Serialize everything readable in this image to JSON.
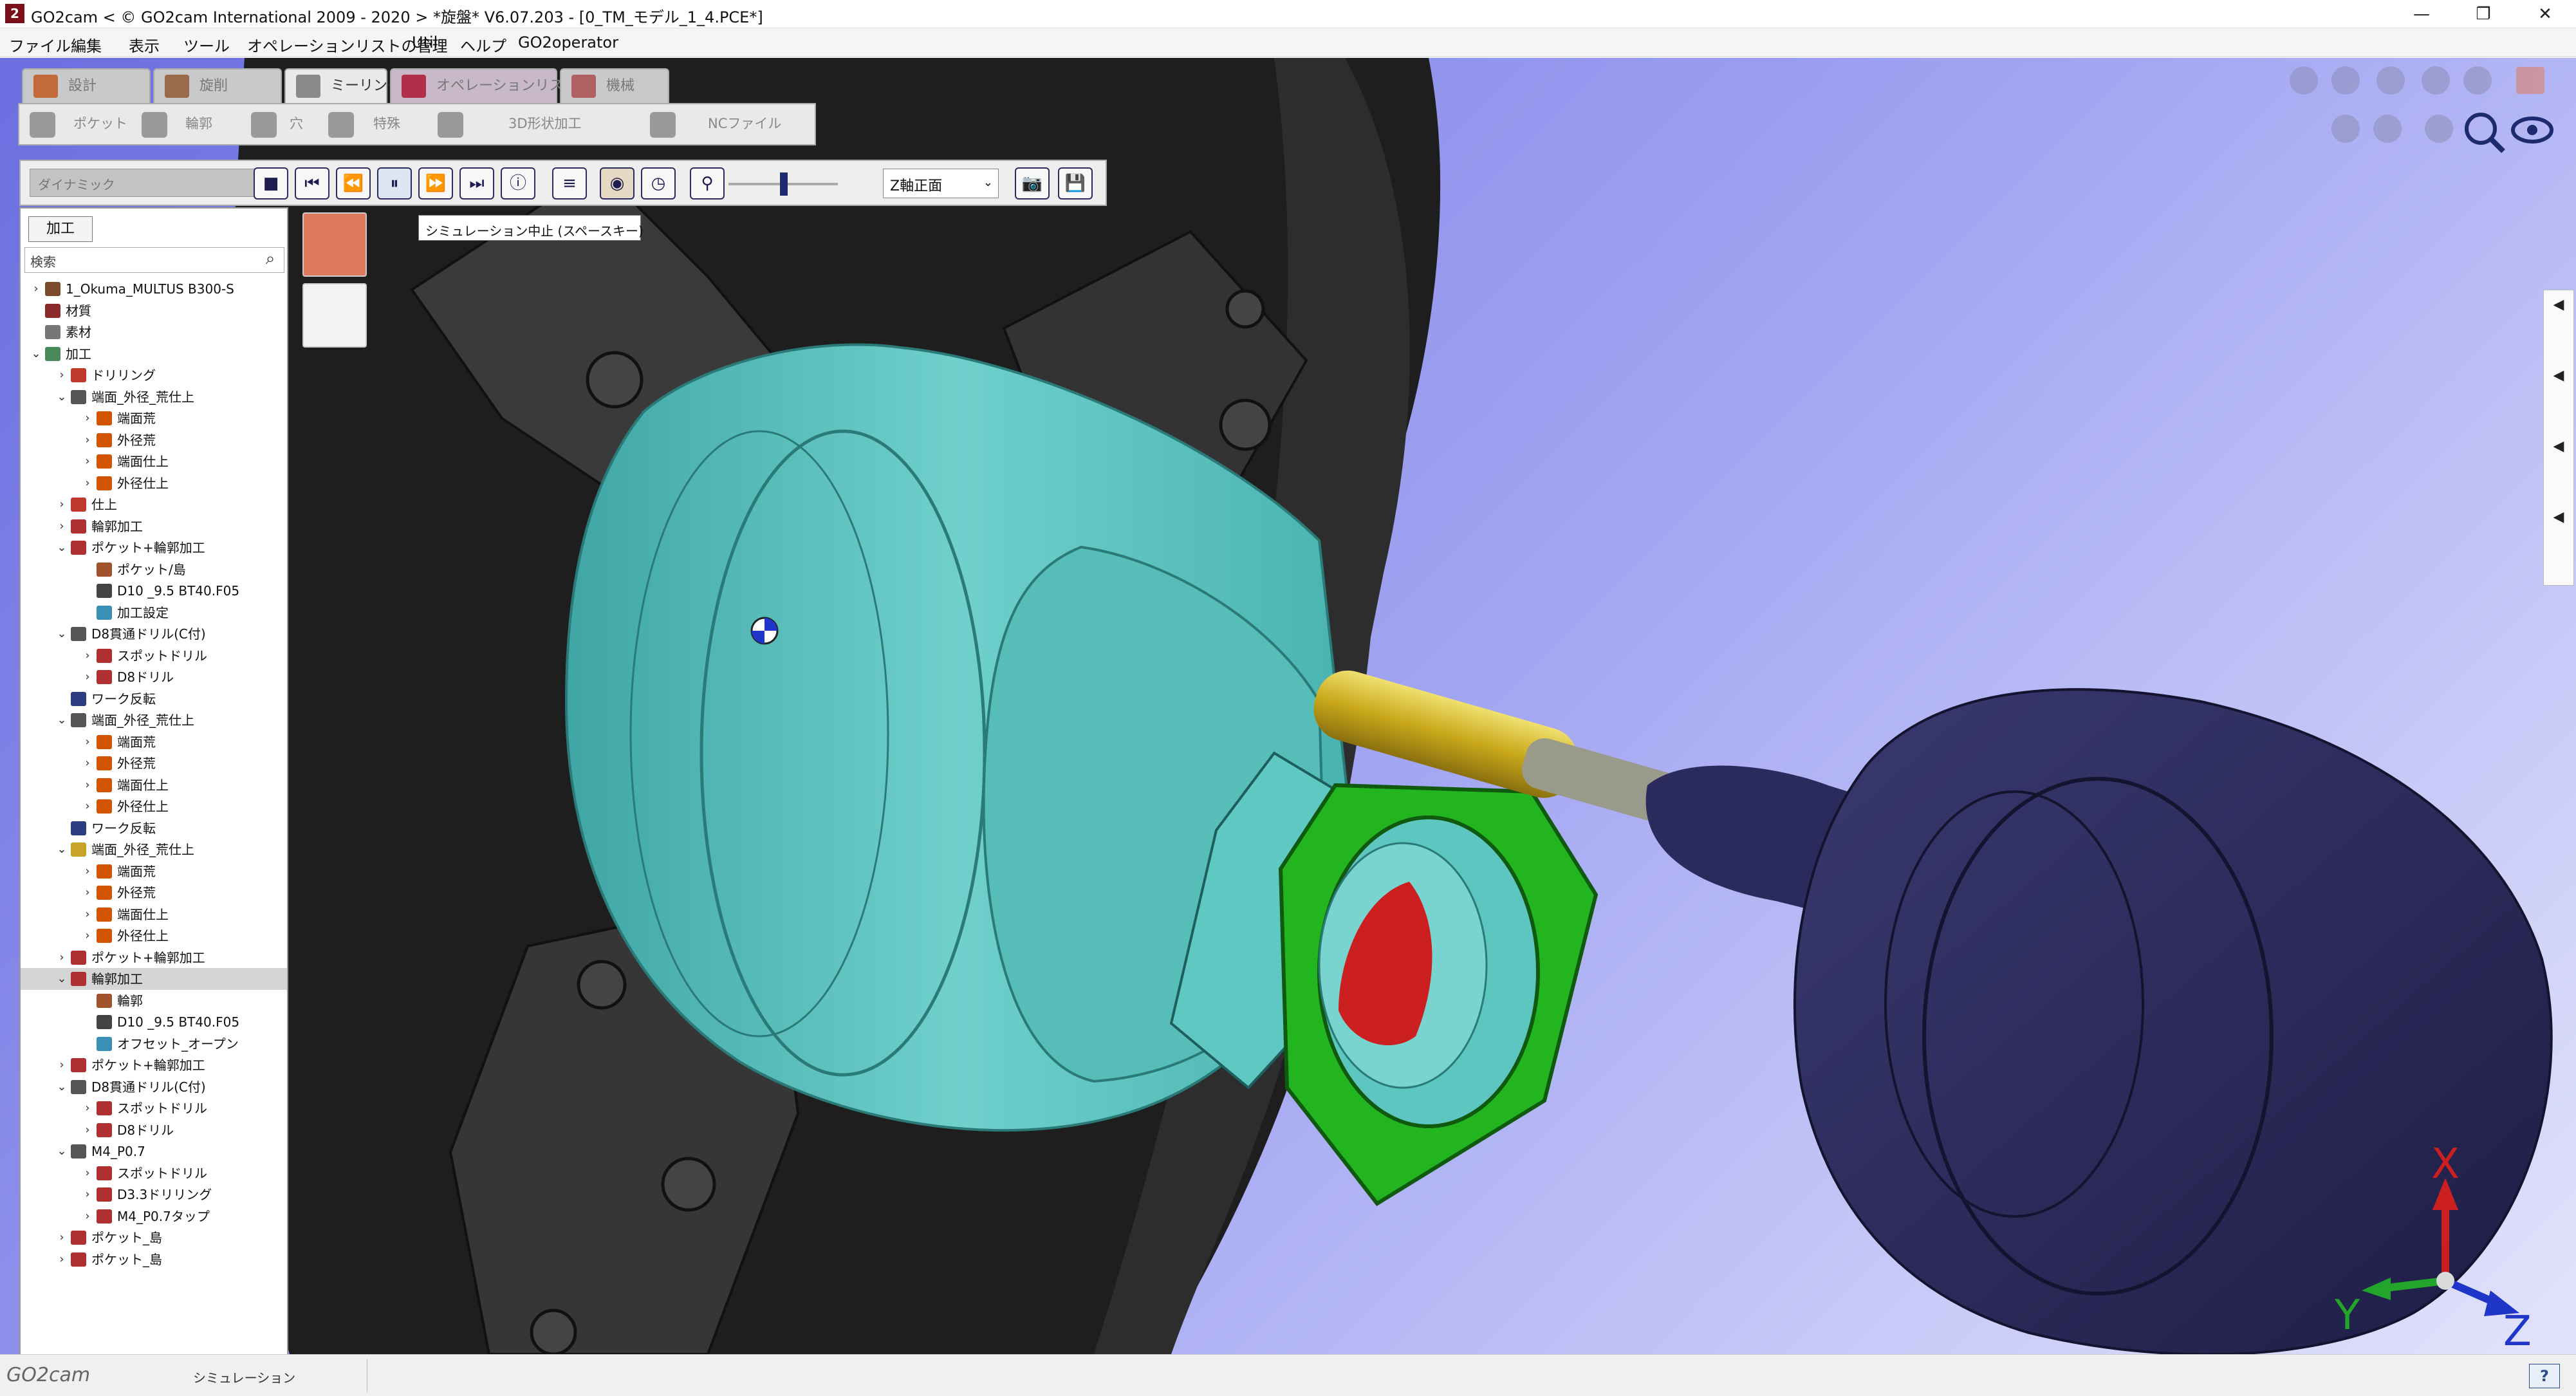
{
  "window": {
    "title": "GO2cam < © GO2cam International 2009 - 2020 >    *旋盤*  V6.07.203 - [0_TM_モデル_1_4.PCE*]",
    "controls": [
      "—",
      "❐",
      "✕"
    ]
  },
  "menu": [
    "ファイル",
    "編集",
    "表示",
    "ツール",
    "オペレーションリストの管理",
    "Util",
    "ヘルプ",
    "GO2operator"
  ],
  "process_tabs": [
    {
      "label": "設計"
    },
    {
      "label": "旋削"
    },
    {
      "label": "ミーリング"
    },
    {
      "label": "オペレーションリスト"
    },
    {
      "label": "機械"
    }
  ],
  "sub_toolbar": [
    "ポケット",
    "輪郭",
    "穴",
    "特殊",
    "3D形状加工",
    "NCファイル"
  ],
  "sim_toolbar": {
    "mode": "ダイナミック",
    "view_select": "Z軸正面",
    "tooltip": "シミュレーション中止 (スペースキー)",
    "buttons": [
      "■",
      "⏮",
      "⏪",
      "⏸",
      "⏩",
      "⏭",
      "ⓘ"
    ]
  },
  "left_panel": {
    "tab": "加工",
    "search_placeholder": "検索",
    "tree": [
      {
        "indent": 0,
        "toggle": "›",
        "icon": "machine-icon",
        "color": "#7a4a2a",
        "label": "1_Okuma_MULTUS B300-S"
      },
      {
        "indent": 0,
        "toggle": "",
        "icon": "material-icon",
        "color": "#8a2a2a",
        "label": "材質"
      },
      {
        "indent": 0,
        "toggle": "",
        "icon": "stock-icon",
        "color": "#777777",
        "label": "素材"
      },
      {
        "indent": 0,
        "toggle": "⌄",
        "icon": "machining-icon",
        "color": "#4a8a5a",
        "label": "加工"
      },
      {
        "indent": 1,
        "toggle": "›",
        "icon": "operation-icon",
        "color": "#c0392b",
        "label": "ドリリング"
      },
      {
        "indent": 1,
        "toggle": "⌄",
        "icon": "group-icon",
        "color": "#555555",
        "label": "端面_外径_荒仕上"
      },
      {
        "indent": 2,
        "toggle": "›",
        "icon": "turning-icon",
        "color": "#d35400",
        "label": "端面荒"
      },
      {
        "indent": 2,
        "toggle": "›",
        "icon": "turning-icon",
        "color": "#d35400",
        "label": "外径荒"
      },
      {
        "indent": 2,
        "toggle": "›",
        "icon": "turning-icon",
        "color": "#d35400",
        "label": "端面仕上"
      },
      {
        "indent": 2,
        "toggle": "›",
        "icon": "turning-icon",
        "color": "#d35400",
        "label": "外径仕上"
      },
      {
        "indent": 1,
        "toggle": "›",
        "icon": "operation-icon",
        "color": "#c0392b",
        "label": "仕上"
      },
      {
        "indent": 1,
        "toggle": "›",
        "icon": "milling-icon",
        "color": "#b03030",
        "label": "輪郭加工"
      },
      {
        "indent": 1,
        "toggle": "⌄",
        "icon": "milling-icon",
        "color": "#b03030",
        "label": "ポケット+輪郭加工"
      },
      {
        "indent": 2,
        "toggle": "",
        "icon": "pocket-icon",
        "color": "#a0522d",
        "label": "ポケット/島"
      },
      {
        "indent": 2,
        "toggle": "",
        "icon": "tool-icon",
        "color": "#444444",
        "label": "D10 _9.5 BT40.F05"
      },
      {
        "indent": 2,
        "toggle": "",
        "icon": "settings-icon",
        "color": "#3a8fb7",
        "label": "加工設定"
      },
      {
        "indent": 1,
        "toggle": "⌄",
        "icon": "group-icon",
        "color": "#555555",
        "label": "D8貫通ドリル(C付)"
      },
      {
        "indent": 2,
        "toggle": "›",
        "icon": "drill-icon",
        "color": "#b03030",
        "label": "スポットドリル"
      },
      {
        "indent": 2,
        "toggle": "›",
        "icon": "drill-icon",
        "color": "#b03030",
        "label": "D8ドリル"
      },
      {
        "indent": 1,
        "toggle": "",
        "icon": "flip-icon",
        "color": "#2c3e80",
        "label": "ワーク反転"
      },
      {
        "indent": 1,
        "toggle": "⌄",
        "icon": "group-icon",
        "color": "#555555",
        "label": "端面_外径_荒仕上"
      },
      {
        "indent": 2,
        "toggle": "›",
        "icon": "turning-icon",
        "color": "#d35400",
        "label": "端面荒"
      },
      {
        "indent": 2,
        "toggle": "›",
        "icon": "turning-icon",
        "color": "#d35400",
        "label": "外径荒"
      },
      {
        "indent": 2,
        "toggle": "›",
        "icon": "turning-icon",
        "color": "#d35400",
        "label": "端面仕上"
      },
      {
        "indent": 2,
        "toggle": "›",
        "icon": "turning-icon",
        "color": "#d35400",
        "label": "外径仕上"
      },
      {
        "indent": 1,
        "toggle": "",
        "icon": "flip-icon",
        "color": "#2c3e80",
        "label": "ワーク反転"
      },
      {
        "indent": 1,
        "toggle": "⌄",
        "icon": "group-icon",
        "color": "#c9a227",
        "label": "端面_外径_荒仕上"
      },
      {
        "indent": 2,
        "toggle": "›",
        "icon": "turning-icon",
        "color": "#d35400",
        "label": "端面荒"
      },
      {
        "indent": 2,
        "toggle": "›",
        "icon": "turning-icon",
        "color": "#d35400",
        "label": "外径荒"
      },
      {
        "indent": 2,
        "toggle": "›",
        "icon": "turning-icon",
        "color": "#d35400",
        "label": "端面仕上"
      },
      {
        "indent": 2,
        "toggle": "›",
        "icon": "turning-icon",
        "color": "#d35400",
        "label": "外径仕上"
      },
      {
        "indent": 1,
        "toggle": "›",
        "icon": "milling-icon",
        "color": "#b03030",
        "label": "ポケット+輪郭加工"
      },
      {
        "indent": 1,
        "toggle": "⌄",
        "icon": "milling-icon",
        "color": "#b03030",
        "label": "輪郭加工",
        "selected": true
      },
      {
        "indent": 2,
        "toggle": "",
        "icon": "contour-icon",
        "color": "#a0522d",
        "label": "輪郭"
      },
      {
        "indent": 2,
        "toggle": "",
        "icon": "tool-icon",
        "color": "#444444",
        "label": "D10 _9.5 BT40.F05"
      },
      {
        "indent": 2,
        "toggle": "",
        "icon": "settings-icon",
        "color": "#3a8fb7",
        "label": "オフセット_オープン"
      },
      {
        "indent": 1,
        "toggle": "›",
        "icon": "milling-icon",
        "color": "#b03030",
        "label": "ポケット+輪郭加工"
      },
      {
        "indent": 1,
        "toggle": "⌄",
        "icon": "group-icon",
        "color": "#555555",
        "label": "D8貫通ドリル(C付)"
      },
      {
        "indent": 2,
        "toggle": "›",
        "icon": "drill-icon",
        "color": "#b03030",
        "label": "スポットドリル"
      },
      {
        "indent": 2,
        "toggle": "›",
        "icon": "drill-icon",
        "color": "#b03030",
        "label": "D8ドリル"
      },
      {
        "indent": 1,
        "toggle": "⌄",
        "icon": "group-icon",
        "color": "#555555",
        "label": "M4_P0.7"
      },
      {
        "indent": 2,
        "toggle": "›",
        "icon": "drill-icon",
        "color": "#b03030",
        "label": "スポットドリル"
      },
      {
        "indent": 2,
        "toggle": "›",
        "icon": "drill-icon",
        "color": "#b03030",
        "label": "D3.3ドリリング"
      },
      {
        "indent": 2,
        "toggle": "›",
        "icon": "tap-icon",
        "color": "#b03030",
        "label": "M4_P0.7タップ"
      },
      {
        "indent": 1,
        "toggle": "›",
        "icon": "milling-icon",
        "color": "#b03030",
        "label": "ポケット_島"
      },
      {
        "indent": 1,
        "toggle": "›",
        "icon": "milling-icon",
        "color": "#b03030",
        "label": "ポケット_島"
      }
    ]
  },
  "axes": {
    "x": "X",
    "y": "Y",
    "z": "Z"
  },
  "status": {
    "brand": "GO2cam",
    "text": "シミュレーション",
    "help": "?"
  },
  "colors": {
    "part": "#62c8c4",
    "face": "#22b51f",
    "hole": "#cc1f1f",
    "tool_holder": "#2b2a5c",
    "chuck": "#1e1e1e",
    "background_top": "#6b6fe0",
    "background_bottom": "#e2e3fb"
  }
}
